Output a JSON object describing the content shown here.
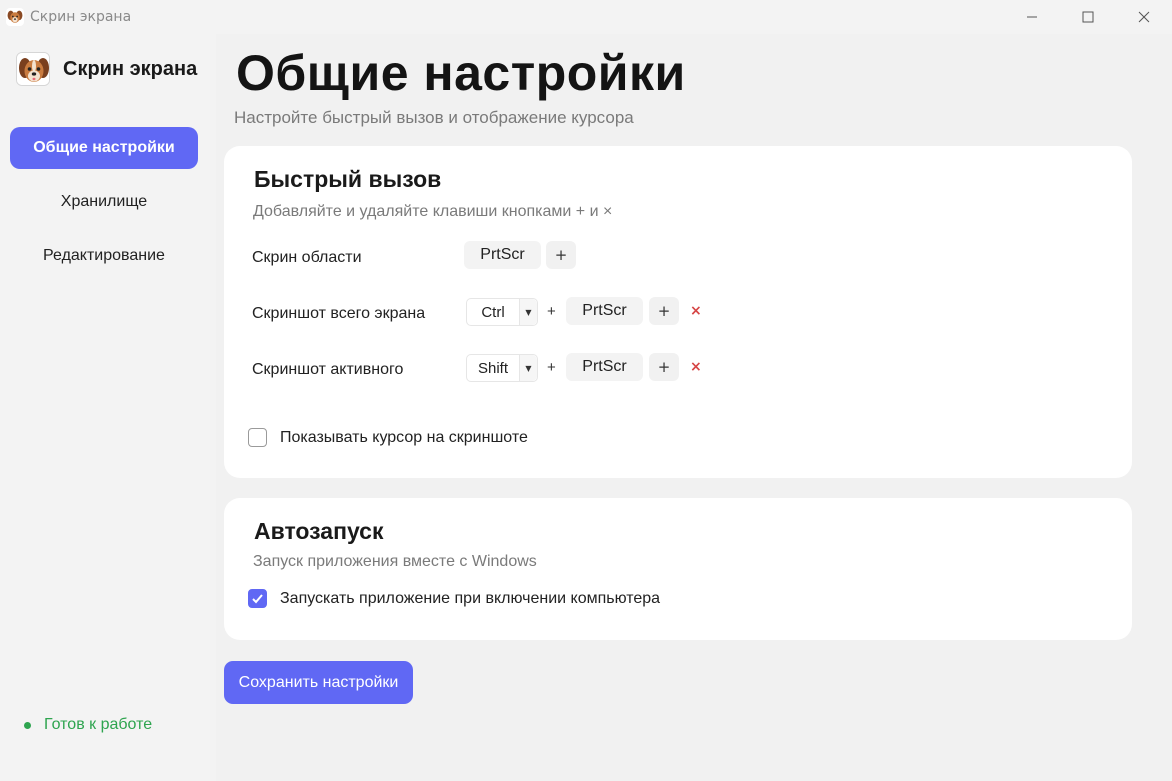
{
  "window": {
    "title": "Скрин экрана",
    "controls": {
      "minimize": "—",
      "maximize": "☐",
      "close": "✕"
    }
  },
  "sidebar": {
    "brand": "Скрин экрана",
    "items": [
      {
        "label": "Общие настройки",
        "active": true
      },
      {
        "label": "Хранилище",
        "active": false
      },
      {
        "label": "Редактирование",
        "active": false
      }
    ],
    "status": "Готов к работе"
  },
  "main": {
    "title": "Общие настройки",
    "subtitle": "Настройте быстрый вызов и отображение курсора",
    "hotkeys": {
      "title": "Быстрый вызов",
      "desc": "Добавляйте и удаляйте клавиши кнопками + и ×",
      "rows": [
        {
          "label": "Скрин области",
          "key": "PrtScr",
          "add": "+"
        },
        {
          "label": "Скриншот всего экрана",
          "modifier": "Ctrl",
          "sep": "+",
          "key": "PrtScr",
          "add": "+",
          "remove": "×"
        },
        {
          "label": "Скриншот активного",
          "modifier": "Shift",
          "sep": "+",
          "key": "PrtScr",
          "add": "+",
          "remove": "×"
        }
      ],
      "show_cursor_label": "Показывать курсор на скриншоте",
      "show_cursor_checked": false
    },
    "autostart": {
      "title": "Автозапуск",
      "desc": "Запуск приложения вместе с Windows",
      "checkbox_label": "Запускать приложение при включении компьютера",
      "checked": true
    },
    "save_label": "Сохранить настройки"
  },
  "colors": {
    "accent": "#6068f4",
    "status_green": "#2ea44f",
    "remove_red": "#d64545"
  }
}
